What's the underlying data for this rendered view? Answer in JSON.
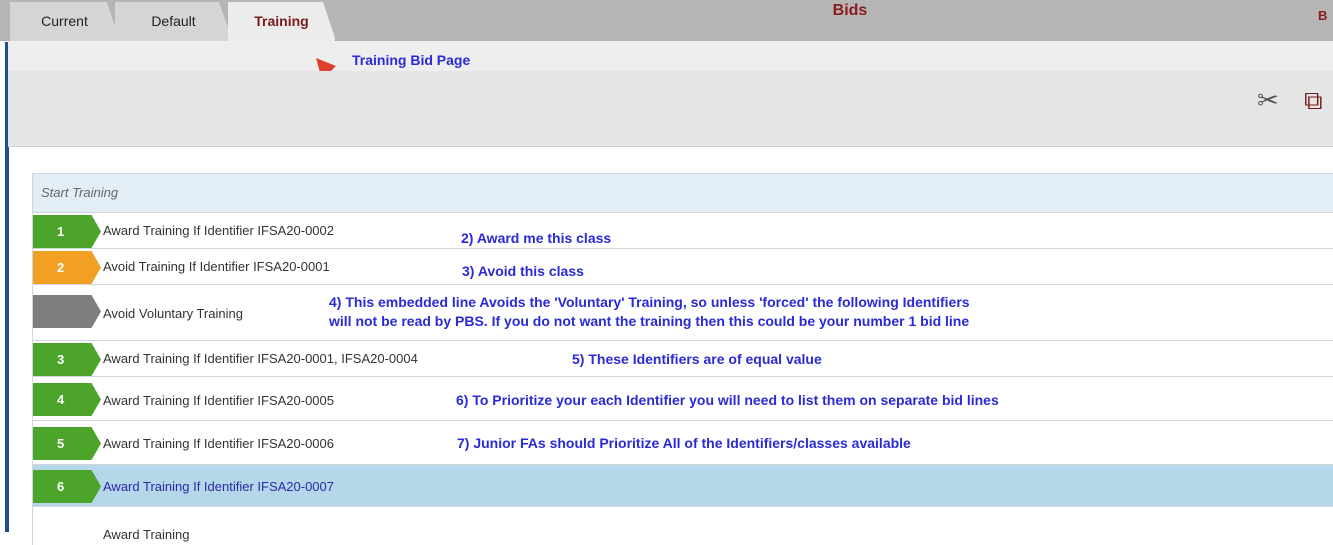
{
  "tabs": [
    "Current",
    "Default",
    "Training"
  ],
  "active_tab": "Training",
  "header": {
    "title": "Bids",
    "right_text": "B"
  },
  "annotation_title": "Training Bid Page",
  "toolbar": {
    "icons": [
      "scissors-icon",
      "copy-icon"
    ]
  },
  "section": {
    "label": "Start Training"
  },
  "rows": [
    {
      "badge": "1",
      "badge_color": "#4ca42a",
      "text": "Award Training If Identifier IFSA20-0002",
      "note": "2) Award me this class"
    },
    {
      "badge": "2",
      "badge_color": "#f2a024",
      "text": "Avoid Training If Identifier IFSA20-0001",
      "note": "3) Avoid this class"
    },
    {
      "badge": "",
      "badge_color": "#7e7e7e",
      "text": "Avoid Voluntary Training",
      "note_line1": "4) This embedded line Avoids the 'Voluntary' Training, so unless 'forced' the following Identifiers",
      "note_line2": "will not be read by PBS. If you do not want the training then this could be your number 1 bid line"
    },
    {
      "badge": "3",
      "badge_color": "#4ca42a",
      "text": "Award Training If Identifier IFSA20-0001, IFSA20-0004",
      "note": "5) These Identifiers are of equal value"
    },
    {
      "badge": "4",
      "badge_color": "#4ca42a",
      "text": "Award Training If Identifier IFSA20-0005",
      "note": "6) To Prioritize your each Identifier you will need to list them on separate bid lines"
    },
    {
      "badge": "5",
      "badge_color": "#4ca42a",
      "text": "Award Training If Identifier IFSA20-0006",
      "note": "7) Junior FAs should Prioritize All of the Identifiers/classes available"
    },
    {
      "badge": "6",
      "badge_color": "#4ca42a",
      "text": "Award Training If Identifier IFSA20-0007",
      "selected": true
    },
    {
      "badge": "",
      "text": "Award Training"
    }
  ]
}
